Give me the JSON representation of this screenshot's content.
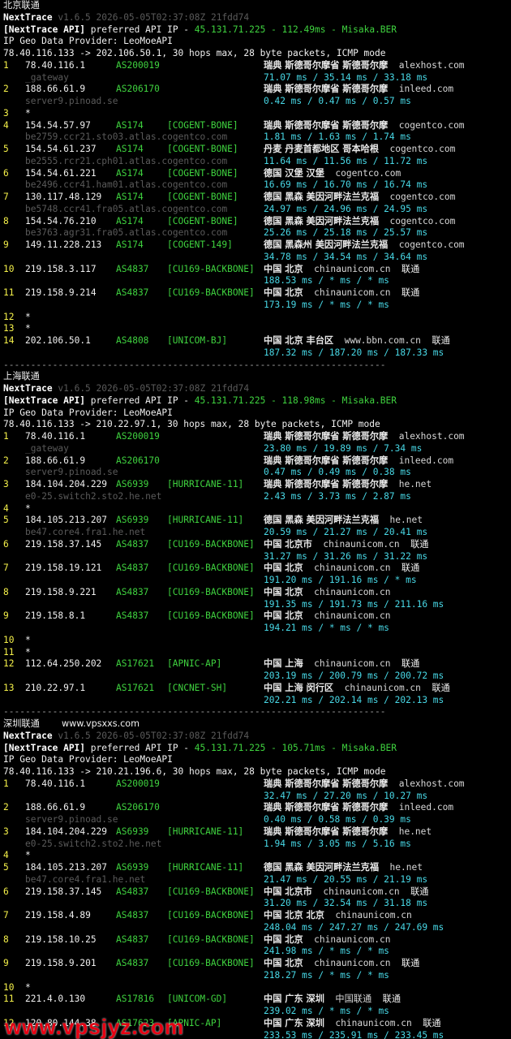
{
  "sections": [
    {
      "title": "北京联通",
      "title_extra": "",
      "header": {
        "app": "NextTrace",
        "version": "v1.6.5 2026-05-05T02:37:08Z 21fdd74",
        "api_tag": "[NextTrace API]",
        "api_text": " preferred API IP - ",
        "api_ip": "45.131.71.225",
        "api_dash": " - ",
        "api_latency": "112.49ms",
        "api_dash2": " - ",
        "api_node": "Misaka.BER",
        "geo_provider": "IP Geo Data Provider: LeoMoeAPI",
        "trace_line": "78.40.116.133 -> 202.106.50.1, 30 hops max, 28 byte packets, ICMP mode"
      },
      "hops": [
        {
          "n": "1",
          "ip": "78.40.116.1",
          "asn": "AS200019",
          "tag": "",
          "geo": "瑞典 斯德哥尔摩省 斯德哥尔摩",
          "host": "alexhost.com",
          "isp": "",
          "rdns": "_gateway",
          "rtt": "71.07 ms / 35.14 ms / 33.18 ms"
        },
        {
          "n": "2",
          "ip": "188.66.61.9",
          "asn": "AS206170",
          "tag": "",
          "geo": "瑞典 斯德哥尔摩省 斯德哥尔摩",
          "host": "inleed.com",
          "isp": "",
          "rdns": "server9.pinoad.se",
          "rtt": "0.42 ms / 0.47 ms / 0.57 ms"
        },
        {
          "n": "3",
          "ip": "*",
          "asn": "",
          "tag": "",
          "geo": "",
          "host": "",
          "isp": "",
          "rdns": "",
          "rtt": ""
        },
        {
          "n": "4",
          "ip": "154.54.57.97",
          "asn": "AS174",
          "tag": "[COGENT-BONE]",
          "geo": "瑞典 斯德哥尔摩省 斯德哥尔摩",
          "host": "cogentco.com",
          "isp": "",
          "rdns": "be2759.ccr21.sto03.atlas.cogentco.com",
          "rtt": "1.81 ms / 1.63 ms / 1.74 ms"
        },
        {
          "n": "5",
          "ip": "154.54.61.237",
          "asn": "AS174",
          "tag": "[COGENT-BONE]",
          "geo": "丹麦 丹麦首都地区 哥本哈根",
          "host": "cogentco.com",
          "isp": "",
          "rdns": "be2555.rcr21.cph01.atlas.cogentco.com",
          "rtt": "11.64 ms / 11.56 ms / 11.72 ms"
        },
        {
          "n": "6",
          "ip": "154.54.61.221",
          "asn": "AS174",
          "tag": "[COGENT-BONE]",
          "geo": "德国 汉堡 汉堡",
          "host": "cogentco.com",
          "isp": "",
          "rdns": "be2496.ccr41.ham01.atlas.cogentco.com",
          "rtt": "16.69 ms / 16.70 ms / 16.74 ms"
        },
        {
          "n": "7",
          "ip": "130.117.48.129",
          "asn": "AS174",
          "tag": "[COGENT-BONE]",
          "geo": "德国 黑森 美因河畔法兰克福",
          "host": "cogentco.com",
          "isp": "",
          "rdns": "be5748.ccr41.fra05.atlas.cogentco.com",
          "rtt": "24.97 ms / 24.96 ms / 24.95 ms"
        },
        {
          "n": "8",
          "ip": "154.54.76.210",
          "asn": "AS174",
          "tag": "[COGENT-BONE]",
          "geo": "德国 黑森 美因河畔法兰克福",
          "host": "cogentco.com",
          "isp": "",
          "rdns": "be3763.agr31.fra05.atlas.cogentco.com",
          "rtt": "25.26 ms / 25.18 ms / 25.57 ms"
        },
        {
          "n": "9",
          "ip": "149.11.228.213",
          "asn": "AS174",
          "tag": "[COGENT-149]",
          "geo": "德国 黑森州 美因河畔法兰克福",
          "host": "cogentco.com",
          "isp": "",
          "rdns": "",
          "rtt": "34.78 ms / 34.54 ms / 34.64 ms"
        },
        {
          "n": "10",
          "ip": "219.158.3.117",
          "asn": "AS4837",
          "tag": "[CU169-BACKBONE]",
          "geo": "中国 北京",
          "host": "chinaunicom.cn",
          "isp": "联通",
          "rdns": "",
          "rtt": "188.53 ms / * ms / * ms"
        },
        {
          "n": "11",
          "ip": "219.158.9.214",
          "asn": "AS4837",
          "tag": "[CU169-BACKBONE]",
          "geo": "中国 北京",
          "host": "chinaunicom.cn",
          "isp": "联通",
          "rdns": "",
          "rtt": "173.19 ms / * ms / * ms"
        },
        {
          "n": "12",
          "ip": "*",
          "asn": "",
          "tag": "",
          "geo": "",
          "host": "",
          "isp": "",
          "rdns": "",
          "rtt": ""
        },
        {
          "n": "13",
          "ip": "*",
          "asn": "",
          "tag": "",
          "geo": "",
          "host": "",
          "isp": "",
          "rdns": "",
          "rtt": ""
        },
        {
          "n": "14",
          "ip": "202.106.50.1",
          "asn": "AS4808",
          "tag": "[UNICOM-BJ]",
          "geo": "中国 北京 丰台区",
          "host": "www.bbn.com.cn",
          "isp": "联通",
          "rdns": "",
          "rtt": "187.32 ms / 187.20 ms / 187.33 ms"
        }
      ]
    },
    {
      "title": "上海联通",
      "title_extra": "",
      "header": {
        "app": "NextTrace",
        "version": "v1.6.5 2026-05-05T02:37:08Z 21fdd74",
        "api_tag": "[NextTrace API]",
        "api_text": " preferred API IP - ",
        "api_ip": "45.131.71.225",
        "api_dash": " - ",
        "api_latency": "118.98ms",
        "api_dash2": " - ",
        "api_node": "Misaka.BER",
        "geo_provider": "IP Geo Data Provider: LeoMoeAPI",
        "trace_line": "78.40.116.133 -> 210.22.97.1, 30 hops max, 28 byte packets, ICMP mode"
      },
      "hops": [
        {
          "n": "1",
          "ip": "78.40.116.1",
          "asn": "AS200019",
          "tag": "",
          "geo": "瑞典 斯德哥尔摩省 斯德哥尔摩",
          "host": "alexhost.com",
          "isp": "",
          "rdns": "_gateway",
          "rtt": "23.80 ms / 19.89 ms / 7.34 ms"
        },
        {
          "n": "2",
          "ip": "188.66.61.9",
          "asn": "AS206170",
          "tag": "",
          "geo": "瑞典 斯德哥尔摩省 斯德哥尔摩",
          "host": "inleed.com",
          "isp": "",
          "rdns": "server9.pinoad.se",
          "rtt": "0.47 ms / 0.49 ms / 0.38 ms"
        },
        {
          "n": "3",
          "ip": "184.104.204.229",
          "asn": "AS6939",
          "tag": "[HURRICANE-11]",
          "geo": "瑞典 斯德哥尔摩省 斯德哥尔摩",
          "host": "he.net",
          "isp": "",
          "rdns": "e0-25.switch2.sto2.he.net",
          "rtt": "2.43 ms / 3.73 ms / 2.87 ms"
        },
        {
          "n": "4",
          "ip": "*",
          "asn": "",
          "tag": "",
          "geo": "",
          "host": "",
          "isp": "",
          "rdns": "",
          "rtt": ""
        },
        {
          "n": "5",
          "ip": "184.105.213.207",
          "asn": "AS6939",
          "tag": "[HURRICANE-11]",
          "geo": "德国 黑森 美因河畔法兰克福",
          "host": "he.net",
          "isp": "",
          "rdns": "be47.core4.fra1.he.net",
          "rtt": "20.59 ms / 21.27 ms / 20.41 ms"
        },
        {
          "n": "6",
          "ip": "219.158.37.145",
          "asn": "AS4837",
          "tag": "[CU169-BACKBONE]",
          "geo": "中国 北京市",
          "host": "chinaunicom.cn",
          "isp": "联通",
          "rdns": "",
          "rtt": "31.27 ms / 31.26 ms / 31.22 ms"
        },
        {
          "n": "7",
          "ip": "219.158.19.121",
          "asn": "AS4837",
          "tag": "[CU169-BACKBONE]",
          "geo": "中国 北京",
          "host": "chinaunicom.cn",
          "isp": "联通",
          "rdns": "",
          "rtt": "191.20 ms / 191.16 ms / * ms"
        },
        {
          "n": "8",
          "ip": "219.158.9.221",
          "asn": "AS4837",
          "tag": "[CU169-BACKBONE]",
          "geo": "中国 北京",
          "host": "chinaunicom.cn",
          "isp": "",
          "rdns": "",
          "rtt": "191.35 ms / 191.73 ms / 211.16 ms"
        },
        {
          "n": "9",
          "ip": "219.158.8.1",
          "asn": "AS4837",
          "tag": "[CU169-BACKBONE]",
          "geo": "中国 北京",
          "host": "chinaunicom.cn",
          "isp": "",
          "rdns": "",
          "rtt": "194.21 ms / * ms / * ms"
        },
        {
          "n": "10",
          "ip": "*",
          "asn": "",
          "tag": "",
          "geo": "",
          "host": "",
          "isp": "",
          "rdns": "",
          "rtt": ""
        },
        {
          "n": "11",
          "ip": "*",
          "asn": "",
          "tag": "",
          "geo": "",
          "host": "",
          "isp": "",
          "rdns": "",
          "rtt": ""
        },
        {
          "n": "12",
          "ip": "112.64.250.202",
          "asn": "AS17621",
          "tag": "[APNIC-AP]",
          "geo": "中国 上海",
          "host": "chinaunicom.cn",
          "isp": "联通",
          "rdns": "",
          "rtt": "203.19 ms / 200.79 ms / 200.72 ms"
        },
        {
          "n": "13",
          "ip": "210.22.97.1",
          "asn": "AS17621",
          "tag": "[CNCNET-SH]",
          "geo": "中国 上海 闵行区",
          "host": "chinaunicom.cn",
          "isp": "联通",
          "rdns": "",
          "rtt": "202.21 ms / 202.14 ms / 202.13 ms"
        }
      ]
    },
    {
      "title": "深圳联通",
      "title_extra": "www.vpsxxs.com",
      "header": {
        "app": "NextTrace",
        "version": "v1.6.5 2026-05-05T02:37:08Z 21fdd74",
        "api_tag": "[NextTrace API]",
        "api_text": " preferred API IP - ",
        "api_ip": "45.131.71.225",
        "api_dash": " - ",
        "api_latency": "105.71ms",
        "api_dash2": " - ",
        "api_node": "Misaka.BER",
        "geo_provider": "IP Geo Data Provider: LeoMoeAPI",
        "trace_line": "78.40.116.133 -> 210.21.196.6, 30 hops max, 28 byte packets, ICMP mode"
      },
      "hops": [
        {
          "n": "1",
          "ip": "78.40.116.1",
          "asn": "AS200019",
          "tag": "",
          "geo": "瑞典 斯德哥尔摩省 斯德哥尔摩",
          "host": "alexhost.com",
          "isp": "",
          "rdns": "",
          "rtt": "32.47 ms / 27.20 ms / 10.27 ms"
        },
        {
          "n": "2",
          "ip": "188.66.61.9",
          "asn": "AS206170",
          "tag": "",
          "geo": "瑞典 斯德哥尔摩省 斯德哥尔摩",
          "host": "inleed.com",
          "isp": "",
          "rdns": "server9.pinoad.se",
          "rtt": "0.40 ms / 0.58 ms / 0.39 ms"
        },
        {
          "n": "3",
          "ip": "184.104.204.229",
          "asn": "AS6939",
          "tag": "[HURRICANE-11]",
          "geo": "瑞典 斯德哥尔摩省 斯德哥尔摩",
          "host": "he.net",
          "isp": "",
          "rdns": "e0-25.switch2.sto2.he.net",
          "rtt": "1.94 ms / 3.05 ms / 5.16 ms"
        },
        {
          "n": "4",
          "ip": "*",
          "asn": "",
          "tag": "",
          "geo": "",
          "host": "",
          "isp": "",
          "rdns": "",
          "rtt": ""
        },
        {
          "n": "5",
          "ip": "184.105.213.207",
          "asn": "AS6939",
          "tag": "[HURRICANE-11]",
          "geo": "德国 黑森 美因河畔法兰克福",
          "host": "he.net",
          "isp": "",
          "rdns": "be47.core4.fra1.he.net",
          "rtt": "21.47 ms / 20.55 ms / 21.19 ms"
        },
        {
          "n": "6",
          "ip": "219.158.37.145",
          "asn": "AS4837",
          "tag": "[CU169-BACKBONE]",
          "geo": "中国 北京市",
          "host": "chinaunicom.cn",
          "isp": "联通",
          "rdns": "",
          "rtt": "31.20 ms / 32.54 ms / 31.18 ms"
        },
        {
          "n": "7",
          "ip": "219.158.4.89",
          "asn": "AS4837",
          "tag": "[CU169-BACKBONE]",
          "geo": "中国 北京 北京",
          "host": "chinaunicom.cn",
          "isp": "",
          "rdns": "",
          "rtt": "248.04 ms / 247.27 ms / 247.69 ms"
        },
        {
          "n": "8",
          "ip": "219.158.10.25",
          "asn": "AS4837",
          "tag": "[CU169-BACKBONE]",
          "geo": "中国 北京",
          "host": "chinaunicom.cn",
          "isp": "",
          "rdns": "",
          "rtt": "241.98 ms / * ms / * ms"
        },
        {
          "n": "9",
          "ip": "219.158.9.201",
          "asn": "AS4837",
          "tag": "[CU169-BACKBONE]",
          "geo": "中国 北京",
          "host": "chinaunicom.cn",
          "isp": "联通",
          "rdns": "",
          "rtt": "218.27 ms / * ms / * ms"
        },
        {
          "n": "10",
          "ip": "*",
          "asn": "",
          "tag": "",
          "geo": "",
          "host": "",
          "isp": "",
          "rdns": "",
          "rtt": ""
        },
        {
          "n": "11",
          "ip": "221.4.0.130",
          "asn": "AS17816",
          "tag": "[UNICOM-GD]",
          "geo": "中国 广东 深圳",
          "host": "中国联通",
          "isp": "联通",
          "rdns": "",
          "rtt": "239.02 ms / * ms / * ms"
        },
        {
          "n": "12",
          "ip": "120.80.144.38",
          "asn": "AS17623",
          "tag": "[APNIC-AP]",
          "geo": "中国 广东 深圳",
          "host": "chinaunicom.cn",
          "isp": "联通",
          "rdns": "",
          "rtt": "233.53 ms / 235.91 ms / 233.45 ms"
        }
      ]
    }
  ],
  "separator": "----------------------------------------------------------------------",
  "watermark": "www.vpsjyz.com",
  "colors": {
    "background": "#000000",
    "hop_number": "#f5f14a",
    "asn": "#3fd33f",
    "rtt": "#48d8e6",
    "rdns": "#5a5a5a",
    "watermark": "#e60012"
  }
}
